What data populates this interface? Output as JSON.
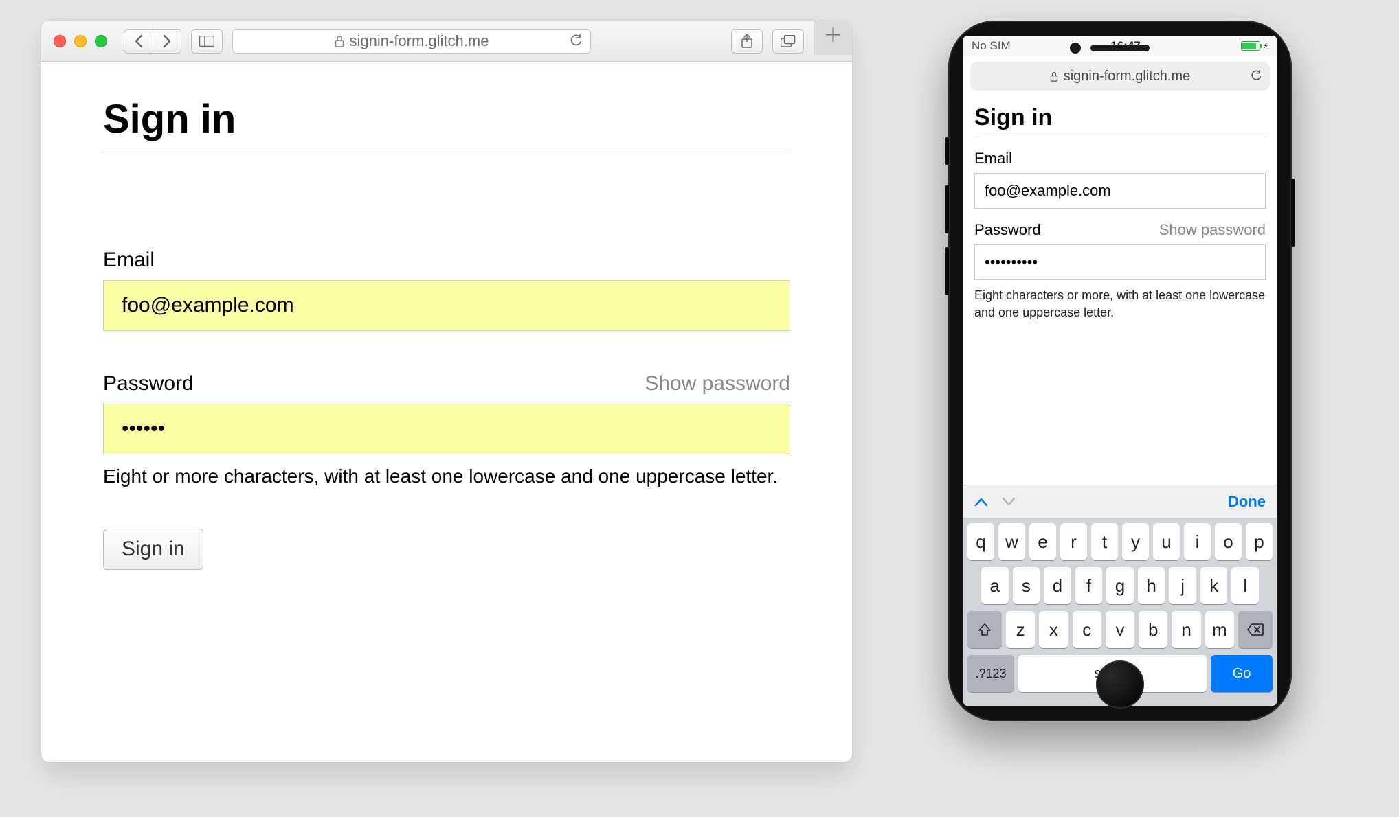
{
  "desktop": {
    "url_host": "signin-form.glitch.me",
    "page": {
      "title": "Sign in",
      "email": {
        "label": "Email",
        "value": "foo@example.com"
      },
      "password": {
        "label": "Password",
        "show_label": "Show password",
        "value": "••••••",
        "hint": "Eight or more characters, with at least one lowercase and one uppercase letter."
      },
      "submit_label": "Sign in"
    }
  },
  "mobile": {
    "status": {
      "carrier": "No SIM",
      "time": "16:47"
    },
    "url_host": "signin-form.glitch.me",
    "page": {
      "title": "Sign in",
      "email": {
        "label": "Email",
        "value": "foo@example.com"
      },
      "password": {
        "label": "Password",
        "show_label": "Show password",
        "value": "••••••••••",
        "hint": "Eight characters or more, with at least one lowercase and one uppercase letter."
      }
    },
    "keyboard": {
      "done_label": "Done",
      "row1": [
        "q",
        "w",
        "e",
        "r",
        "t",
        "y",
        "u",
        "i",
        "o",
        "p"
      ],
      "row2": [
        "a",
        "s",
        "d",
        "f",
        "g",
        "h",
        "j",
        "k",
        "l"
      ],
      "row3": [
        "z",
        "x",
        "c",
        "v",
        "b",
        "n",
        "m"
      ],
      "mode_label": ".?123",
      "space_label": "space",
      "go_label": "Go"
    }
  }
}
